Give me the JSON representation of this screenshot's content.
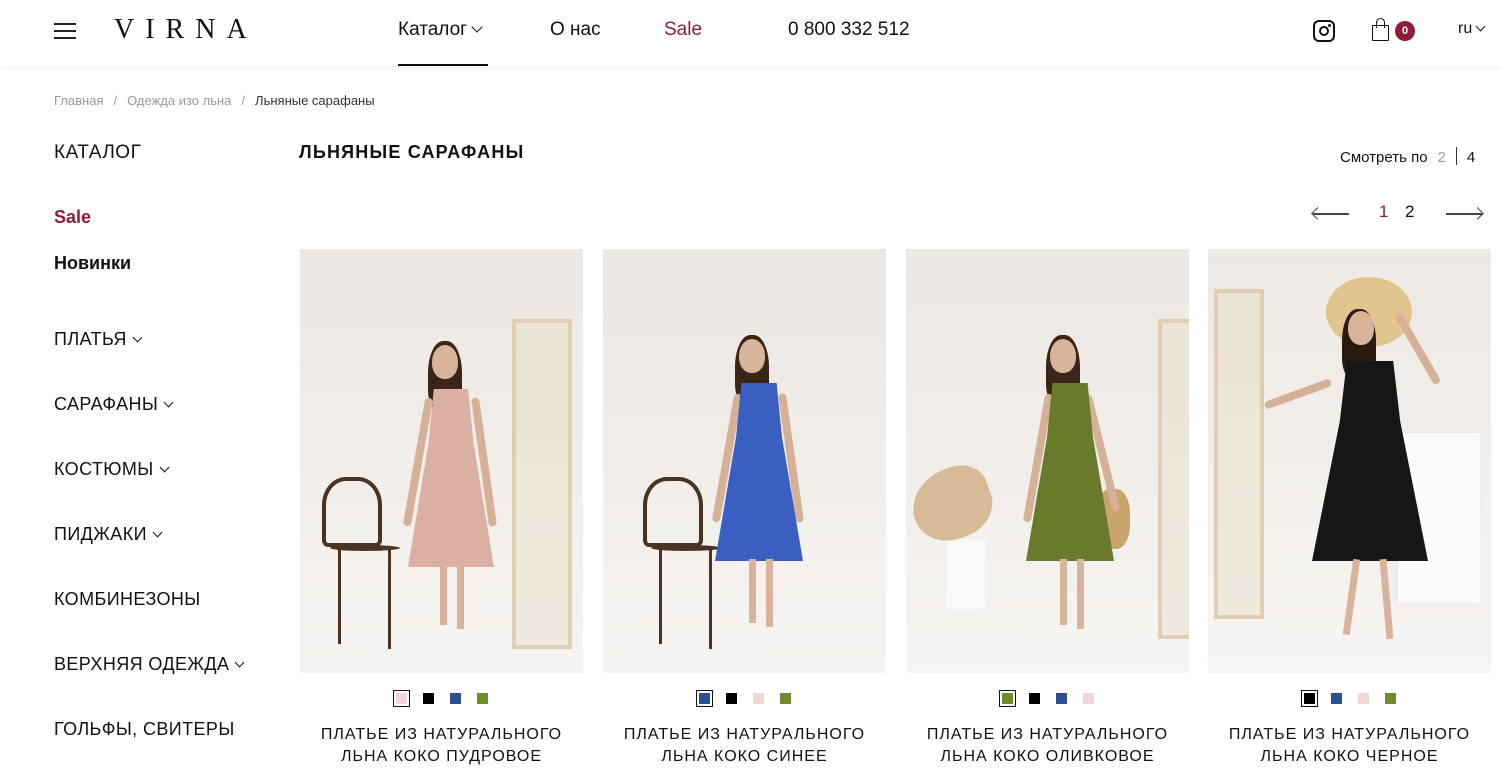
{
  "header": {
    "logo": "VIRNA",
    "nav": {
      "catalog": "Каталог",
      "about": "О нас",
      "sale": "Sale",
      "phone": "0 800 332 512"
    },
    "cart_count": "0",
    "lang": "ru",
    "accent_color": "#8c1c3a"
  },
  "breadcrumb": [
    "Главная",
    "Одежда изо льна",
    "Льняные сарафаны"
  ],
  "sidebar": {
    "title": "КАТАЛОГ",
    "sale": "Sale",
    "new": "Новинки",
    "categories": [
      {
        "label": "ПЛАТЬЯ",
        "has_submenu": true
      },
      {
        "label": "САРАФАНЫ",
        "has_submenu": true
      },
      {
        "label": "КОСТЮМЫ",
        "has_submenu": true
      },
      {
        "label": "ПИДЖАКИ",
        "has_submenu": true
      },
      {
        "label": "КОМБИНЕЗОНЫ",
        "has_submenu": false
      },
      {
        "label": "ВЕРХНЯЯ ОДЕЖДА",
        "has_submenu": true
      },
      {
        "label": "ГОЛЬФЫ, СВИТЕРЫ",
        "has_submenu": false
      }
    ]
  },
  "main": {
    "title": "ЛЬНЯНЫЕ САРАФАНЫ",
    "view_by": {
      "label": "Смотреть по",
      "opt_a": "2",
      "opt_b": "4"
    },
    "pagination": {
      "page1": "1",
      "page2": "2"
    }
  },
  "products": [
    {
      "name_line1": "ПЛАТЬЕ ИЗ НАТУРАЛЬНОГО",
      "name_line2": "ЛЬНА КОКО ПУДРОВОЕ",
      "dress_color": "#d9b0a2",
      "swatches": [
        "#f0d6d8",
        "#000000",
        "#2b4f93",
        "#6b8e2a"
      ],
      "selected": 0
    },
    {
      "name_line1": "ПЛАТЬЕ ИЗ НАТУРАЛЬНОГО",
      "name_line2": "ЛЬНА КОКО СИНЕЕ",
      "dress_color": "#3b5fc0",
      "swatches": [
        "#2b4f93",
        "#000000",
        "#f0d6d8",
        "#6b8e2a"
      ],
      "selected": 0
    },
    {
      "name_line1": "ПЛАТЬЕ ИЗ НАТУРАЛЬНОГО",
      "name_line2": "ЛЬНА КОКО ОЛИВКОВОЕ",
      "dress_color": "#6a7a2c",
      "swatches": [
        "#6b8e2a",
        "#000000",
        "#2b4f93",
        "#f0d6d8"
      ],
      "selected": 0
    },
    {
      "name_line1": "ПЛАТЬЕ ИЗ НАТУРАЛЬНОГО",
      "name_line2": "ЛЬНА КОКО ЧЕРНОЕ",
      "dress_color": "#161616",
      "swatches": [
        "#000000",
        "#2b4f93",
        "#f0d6d8",
        "#6b8e2a"
      ],
      "selected": 0
    }
  ]
}
